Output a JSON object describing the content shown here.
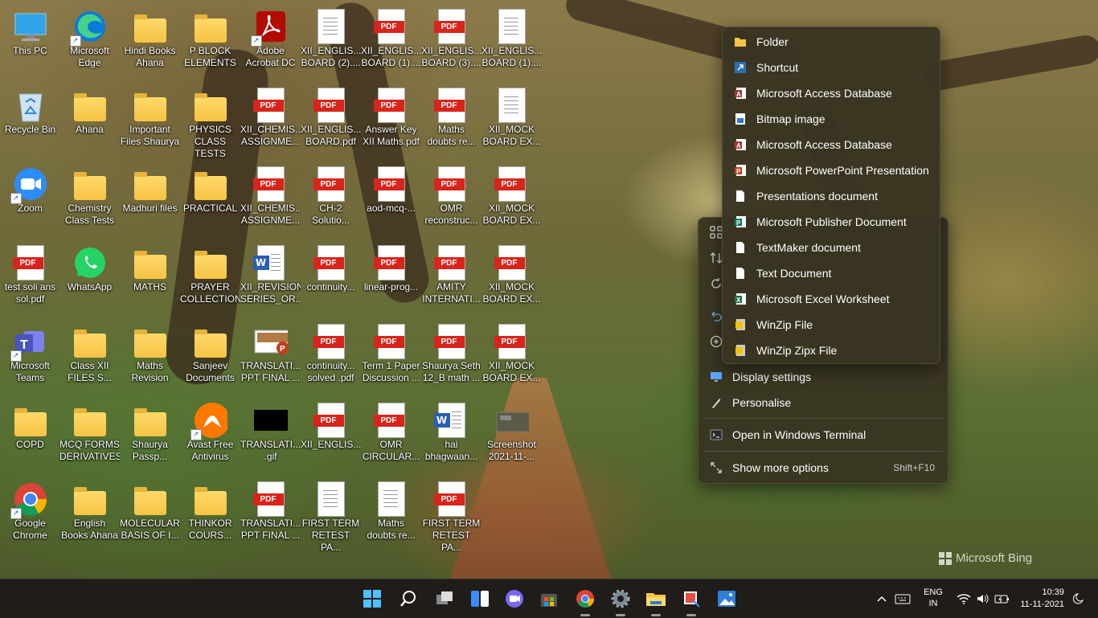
{
  "desktop": {
    "icons": [
      {
        "label": "This PC",
        "type": "pc"
      },
      {
        "label": "Microsoft\nEdge",
        "type": "edge"
      },
      {
        "label": "Hindi Books\nAhana",
        "type": "folder"
      },
      {
        "label": "P BLOCK\nELEMENTS",
        "type": "folder"
      },
      {
        "label": "Adobe\nAcrobat DC",
        "type": "acrobat"
      },
      {
        "label": "XII_ENGLIS...\nBOARD (2)....",
        "type": "doc"
      },
      {
        "label": "XII_ENGLIS...\nBOARD (1)....",
        "type": "pdf"
      },
      {
        "label": "XII_ENGLIS...\nBOARD (3)....",
        "type": "pdf"
      },
      {
        "label": "XII_ENGLIS...\nBOARD (1)....",
        "type": "doc"
      },
      {
        "label": "Recycle Bin",
        "type": "bin"
      },
      {
        "label": "Ahana",
        "type": "folder"
      },
      {
        "label": "Important\nFiles Shaurya",
        "type": "folder"
      },
      {
        "label": "PHYSICS\nCLASS TESTS",
        "type": "folder"
      },
      {
        "label": "XII_CHEMIS...\nASSIGNME...",
        "type": "pdf"
      },
      {
        "label": "XII_ENGLIS...\nBOARD.pdf",
        "type": "pdf"
      },
      {
        "label": "Answer Key\nXII Maths.pdf",
        "type": "pdf"
      },
      {
        "label": "Maths\ndoubts re...",
        "type": "pdf"
      },
      {
        "label": "XII_MOCK\nBOARD EX...",
        "type": "doc"
      },
      {
        "label": "Zoom",
        "type": "zoom"
      },
      {
        "label": "Chemistry\nClass Tests",
        "type": "folder"
      },
      {
        "label": "Madhuri files",
        "type": "folder"
      },
      {
        "label": "PRACTICAL",
        "type": "folder"
      },
      {
        "label": "XII_CHEMIS...\nASSIGNME...",
        "type": "pdf"
      },
      {
        "label": "CH-2\nSolutio...",
        "type": "pdf"
      },
      {
        "label": "aod-mcq-...",
        "type": "pdf"
      },
      {
        "label": "OMR\nreconstruc...",
        "type": "pdf"
      },
      {
        "label": "XII_MOCK\nBOARD EX...",
        "type": "pdf"
      },
      {
        "label": "test soli ans\nsol.pdf",
        "type": "pdf"
      },
      {
        "label": "WhatsApp",
        "type": "whatsapp"
      },
      {
        "label": "MATHS",
        "type": "folder"
      },
      {
        "label": "PRAYER\nCOLLECTION",
        "type": "folder"
      },
      {
        "label": "XII_REVISION\nSERIES_OR...",
        "type": "word"
      },
      {
        "label": "continuity...",
        "type": "pdf"
      },
      {
        "label": "linear-prog...",
        "type": "pdf"
      },
      {
        "label": "AMITY\nINTERNATI...",
        "type": "pdf"
      },
      {
        "label": "XII_MOCK\nBOARD EX...",
        "type": "pdf"
      },
      {
        "label": "Microsoft\nTeams",
        "type": "teams"
      },
      {
        "label": "Class XII\nFILES S...",
        "type": "folder"
      },
      {
        "label": "Maths\nRevision",
        "type": "folder"
      },
      {
        "label": "Sanjeev\nDocuments",
        "type": "folder"
      },
      {
        "label": "TRANSLATI...\nPPT FINAL ...",
        "type": "ppt"
      },
      {
        "label": "continuity...\nsolved .pdf",
        "type": "pdf"
      },
      {
        "label": "Term 1 Paper\nDiscussion ...",
        "type": "pdf"
      },
      {
        "label": "Shaurya Seth\n12_B math ...",
        "type": "pdf"
      },
      {
        "label": "XII_MOCK\nBOARD EX...",
        "type": "pdf"
      },
      {
        "label": "COPD",
        "type": "folder"
      },
      {
        "label": "MCQ FORMS\nDERIVATIVES",
        "type": "folder"
      },
      {
        "label": "Shaurya\nPassp...",
        "type": "folder"
      },
      {
        "label": "Avast Free\nAntivirus",
        "type": "avast"
      },
      {
        "label": "TRANSLATI...\n.gif",
        "type": "gif"
      },
      {
        "label": "XII_ENGLIS...",
        "type": "pdf"
      },
      {
        "label": "OMR\nCIRCULAR...",
        "type": "pdf"
      },
      {
        "label": "hai\nbhagwaan...",
        "type": "word"
      },
      {
        "label": "Screenshot\n2021-11-...",
        "type": "screenshot"
      },
      {
        "label": "Google\nChrome",
        "type": "chrome"
      },
      {
        "label": "English\nBooks Ahana",
        "type": "folder"
      },
      {
        "label": "MOLECULAR\nBASIS OF I...",
        "type": "folder"
      },
      {
        "label": "THINKOR\nCOURS...",
        "type": "folder"
      },
      {
        "label": "TRANSLATI...\nPPT FINAL ...",
        "type": "pdf"
      },
      {
        "label": "FIRST TERM\nRETEST PA...",
        "type": "doc"
      },
      {
        "label": "Maths\ndoubts re...",
        "type": "doc"
      },
      {
        "label": "FIRST TERM\nRETEST PA...",
        "type": "pdf"
      }
    ]
  },
  "wallpaper": {
    "brand": "Microsoft Bing"
  },
  "context_menu": {
    "new_submenu": [
      {
        "label": "Folder",
        "icon": "folder-icon",
        "color": "#f6c344"
      },
      {
        "label": "Shortcut",
        "icon": "shortcut-icon",
        "color": "#4aa3ff"
      },
      {
        "label": "Microsoft Access Database",
        "icon": "access-icon",
        "color": "#a4373a"
      },
      {
        "label": "Bitmap image",
        "icon": "bitmap-icon",
        "color": "#cfd8e3"
      },
      {
        "label": "Microsoft Access Database",
        "icon": "access-icon",
        "color": "#a4373a"
      },
      {
        "label": "Microsoft PowerPoint Presentation",
        "icon": "powerpoint-icon",
        "color": "#c43e1c"
      },
      {
        "label": "Presentations document",
        "icon": "document-icon",
        "color": "#ffffff"
      },
      {
        "label": "Microsoft Publisher Document",
        "icon": "publisher-icon",
        "color": "#077568"
      },
      {
        "label": "TextMaker document",
        "icon": "document-icon",
        "color": "#ffffff"
      },
      {
        "label": "Text Document",
        "icon": "text-document-icon",
        "color": "#ffffff"
      },
      {
        "label": "Microsoft Excel Worksheet",
        "icon": "excel-icon",
        "color": "#1d6f42"
      },
      {
        "label": "WinZip File",
        "icon": "winzip-icon",
        "color": "#f2c200"
      },
      {
        "label": "WinZip Zipx File",
        "icon": "winzip-icon",
        "color": "#f2c200"
      }
    ],
    "main": {
      "display_settings": "Display settings",
      "personalise": "Personalise",
      "terminal": "Open in Windows Terminal",
      "more_options": "Show more options",
      "more_options_shortcut": "Shift+F10"
    }
  },
  "taskbar": {
    "lang_top": "ENG",
    "lang_bottom": "IN",
    "time": "10:39",
    "date": "11-11-2021"
  }
}
